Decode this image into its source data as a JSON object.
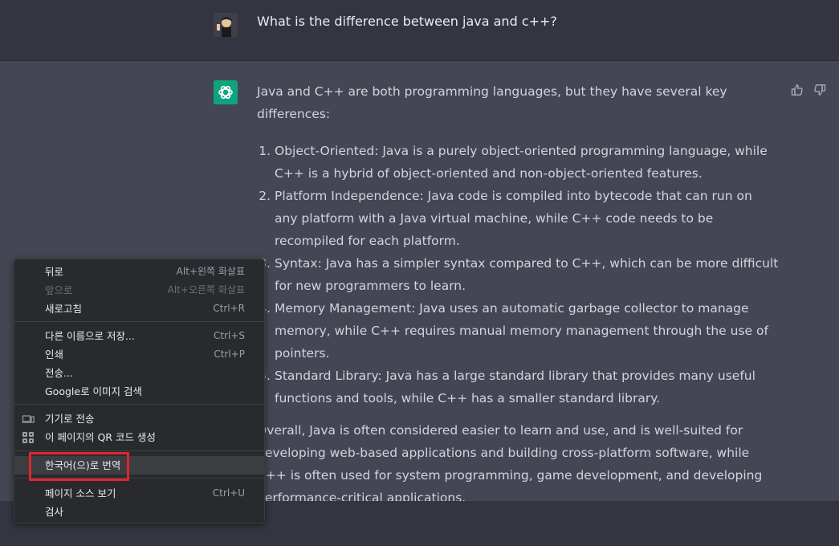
{
  "user_message": "What is the difference between java and c++?",
  "assistant": {
    "intro": "Java and C++ are both programming languages, but they have several key differences:",
    "items": [
      "Object-Oriented: Java is a purely object-oriented programming language, while C++ is a hybrid of object-oriented and non-object-oriented features.",
      "Platform Independence: Java code is compiled into bytecode that can run on any platform with a Java virtual machine, while C++ code needs to be recompiled for each platform.",
      "Syntax: Java has a simpler syntax compared to C++, which can be more difficult for new programmers to learn.",
      "Memory Management: Java uses an automatic garbage collector to manage memory, while C++ requires manual memory management through the use of pointers.",
      "Standard Library: Java has a large standard library that provides many useful functions and tools, while C++ has a smaller standard library."
    ],
    "conclusion": "Overall, Java is often considered easier to learn and use, and is well-suited for developing web-based applications and building cross-platform software, while C++ is often used for system programming, game development, and developing performance-critical applications."
  },
  "context_menu": {
    "back": {
      "label": "뒤로",
      "shortcut": "Alt+왼쪽 화살표"
    },
    "forward": {
      "label": "앞으로",
      "shortcut": "Alt+오른쪽 화살표"
    },
    "reload": {
      "label": "새로고침",
      "shortcut": "Ctrl+R"
    },
    "save_as": {
      "label": "다른 이름으로 저장...",
      "shortcut": "Ctrl+S"
    },
    "print": {
      "label": "인쇄",
      "shortcut": "Ctrl+P"
    },
    "cast": {
      "label": "전송..."
    },
    "google_image": {
      "label": "Google로 이미지 검색"
    },
    "send_to_device": {
      "label": "기기로 전송"
    },
    "qr_code": {
      "label": "이 페이지의 QR 코드 생성"
    },
    "translate": {
      "label": "한국어(으)로 번역"
    },
    "view_source": {
      "label": "페이지 소스 보기",
      "shortcut": "Ctrl+U"
    },
    "inspect": {
      "label": "검사"
    }
  },
  "colors": {
    "highlight_box": "#e0262c",
    "gpt_logo": "#10a37f"
  }
}
